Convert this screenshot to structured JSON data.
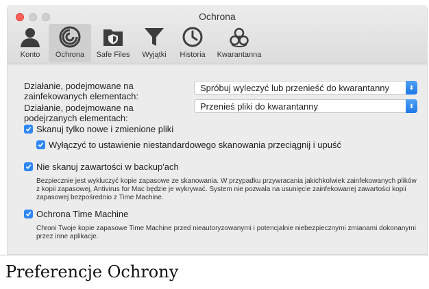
{
  "window": {
    "title": "Ochrona"
  },
  "toolbar": {
    "tabs": [
      {
        "label": "Konto",
        "icon": "user-icon"
      },
      {
        "label": "Ochrona",
        "icon": "protection-icon",
        "active": true
      },
      {
        "label": "Safe Files",
        "icon": "safe-files-icon"
      },
      {
        "label": "Wyjątki",
        "icon": "funnel-icon"
      },
      {
        "label": "Historia",
        "icon": "clock-icon"
      },
      {
        "label": "Kwarantanna",
        "icon": "biohazard-icon"
      }
    ]
  },
  "settings": {
    "infected_label_1": "Działanie, podejmowane na",
    "infected_label_2": "zainfekowanych elementach:",
    "infected_value": "Spróbuj wyleczyć lub przenieść do kwarantanny",
    "suspicious_label_1": "Działanie, podejmowane na",
    "suspicious_label_2": "podejrzanych elementach:",
    "suspicious_value": "Przenieś pliki do kwarantanny",
    "scan_new_only": "Skanuj tylko nowe i zmienione pliki",
    "disable_custom_dragdrop": "Wyłączyć to ustawienie niestandardowego skanowania przeciągnij i upuść",
    "skip_backups": "Nie skanuj zawartości w backup'ach",
    "skip_backups_desc": "Bezpiecznie jest wykluczyć kopie zapasowe ze skanowania. W przypadku przywracania jakichkolwiek zainfekowanych plików z kopii zapasowej, Antivirus for Mac będzie je wykrywać. System nie pozwala na usunięcie zainfekowanej zawartości kopii zapasowej bezpośrednio z Time Machine.",
    "time_machine": "Ochrona Time Machine",
    "time_machine_desc": "Chroni Twoje kopie zapasowe Time Machine przed nieautoryzowanymi i potencjalnie niebezpiecznymi zmianami dokonanymi przez inne aplikacje."
  },
  "caption": "Preferencje Ochrony",
  "colors": {
    "accent": "#2f86f5",
    "close": "#fc5f57"
  }
}
